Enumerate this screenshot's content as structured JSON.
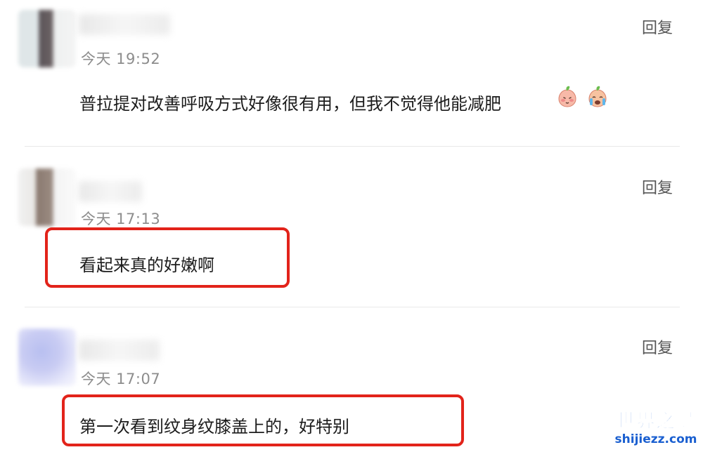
{
  "comments": [
    {
      "time": "今天 19:52",
      "text": "普拉提对改善呼吸方式好像很有用，但我不觉得他能减肥",
      "reply": "回复",
      "emojis": [
        "peach-blush-emoji",
        "peach-crying-emoji"
      ],
      "highlighted": false
    },
    {
      "time": "今天 17:13",
      "text": "看起来真的好嫩啊",
      "reply": "回复",
      "highlighted": true
    },
    {
      "time": "今天 17:07",
      "text": "第一次看到纹身纹膝盖上的，好特别",
      "reply": "回复",
      "highlighted": true
    }
  ],
  "highlight_color": "#e2231a",
  "watermark": {
    "title": "世界之最",
    "domain": "shijiezz.com",
    "color": "#1a5fd0"
  }
}
